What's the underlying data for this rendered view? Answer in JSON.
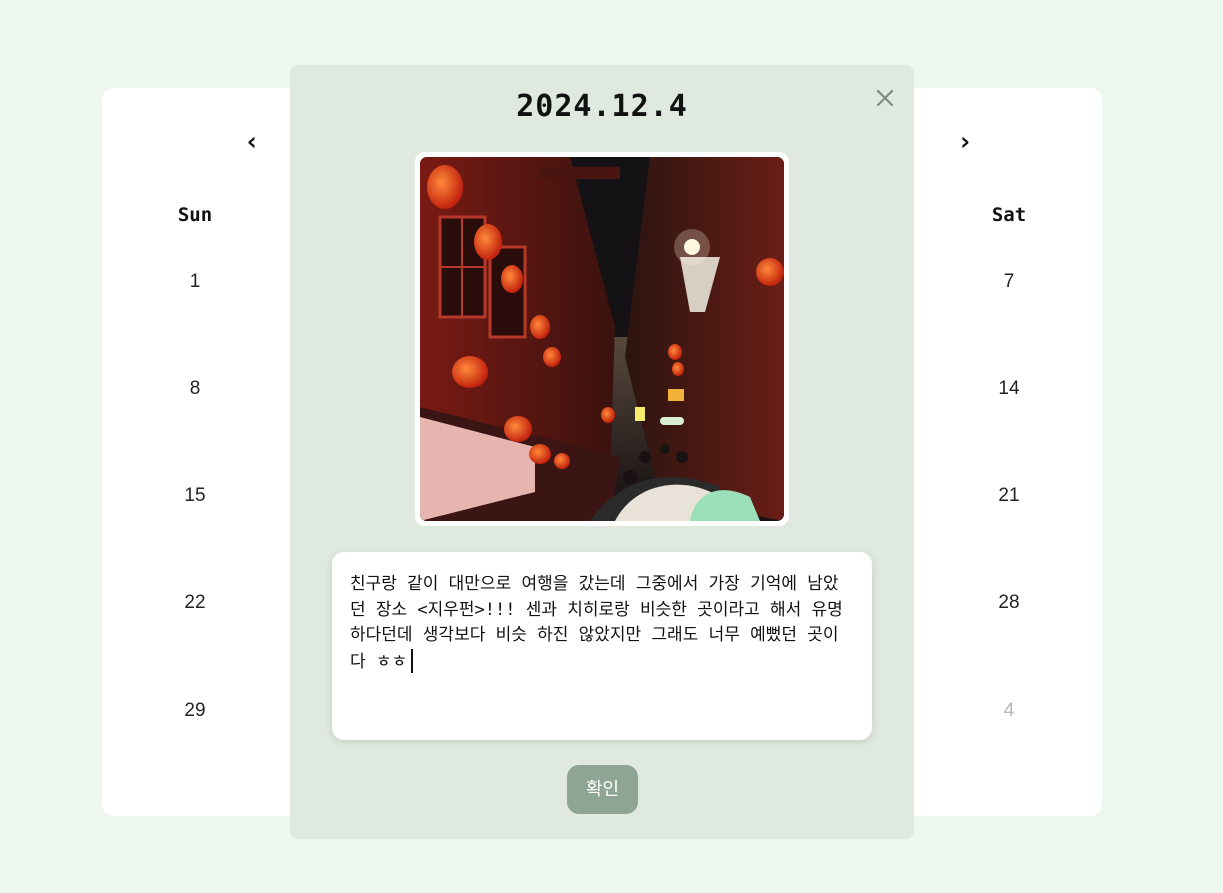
{
  "calendar": {
    "prev_icon": "‹",
    "next_icon": "›",
    "headers": {
      "sun": "Sun",
      "sat": "Sat"
    },
    "sun_days": [
      "1",
      "8",
      "15",
      "22",
      "29"
    ],
    "sat_days": [
      "7",
      "14",
      "21",
      "28",
      "4"
    ]
  },
  "modal": {
    "date": "2024.12.4",
    "photo_alt": "night alley with red lanterns",
    "memo_text": "친구랑 같이 대만으로 여행을 갔는데 그중에서 가장 기억에 남았던 장소 <지우펀>!!! 센과 치히로랑 비슷한 곳이라고 해서 유명하다던데 생각보다 비슷 하진 않았지만 그래도 너무 예뻤던 곳이다 ㅎㅎ",
    "confirm_label": "확인"
  },
  "colors": {
    "page_bg": "#eef7ef",
    "modal_bg": "#dfe9df",
    "button_bg": "#8fa594",
    "muted_day": "#b8b8b8"
  }
}
